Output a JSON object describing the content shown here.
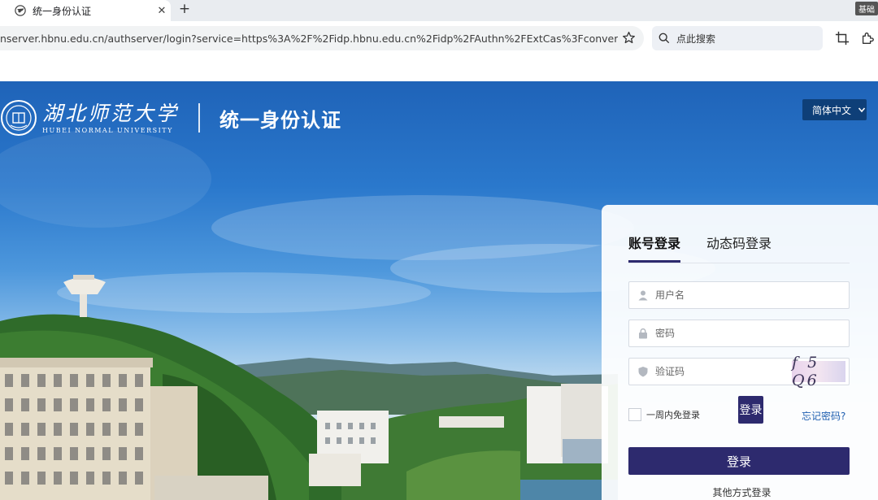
{
  "browser": {
    "tab_title": "统一身份认证",
    "corner_badge": "基础",
    "url": "nserver.hbnu.edu.cn/authserver/login?service=https%3A%2F%2Fidp.hbnu.edu.cn%2Fidp%2FAuthn%2FExtCas%3Fconversation%3De2…",
    "search_placeholder": "点此搜索"
  },
  "header": {
    "logo_cn": "湖北师范大学",
    "logo_en": "HUBEI NORMAL UNIVERSITY",
    "title": "统一身份认证",
    "language": "简体中文"
  },
  "login": {
    "tabs": [
      "账号登录",
      "动态码登录"
    ],
    "active_tab": 0,
    "username_placeholder": "用户名",
    "password_placeholder": "密码",
    "captcha_placeholder": "验证码",
    "captcha_text": "f 5 Q6",
    "remember_label": "一周内免登录",
    "mid_button": "登录",
    "forgot_label": "忘记密码?",
    "submit_label": "登录",
    "other_methods": "其他方式登录"
  },
  "colors": {
    "accent": "#2d2a6e",
    "link": "#1f5fb0",
    "lang_bg": "#0e3f78"
  }
}
